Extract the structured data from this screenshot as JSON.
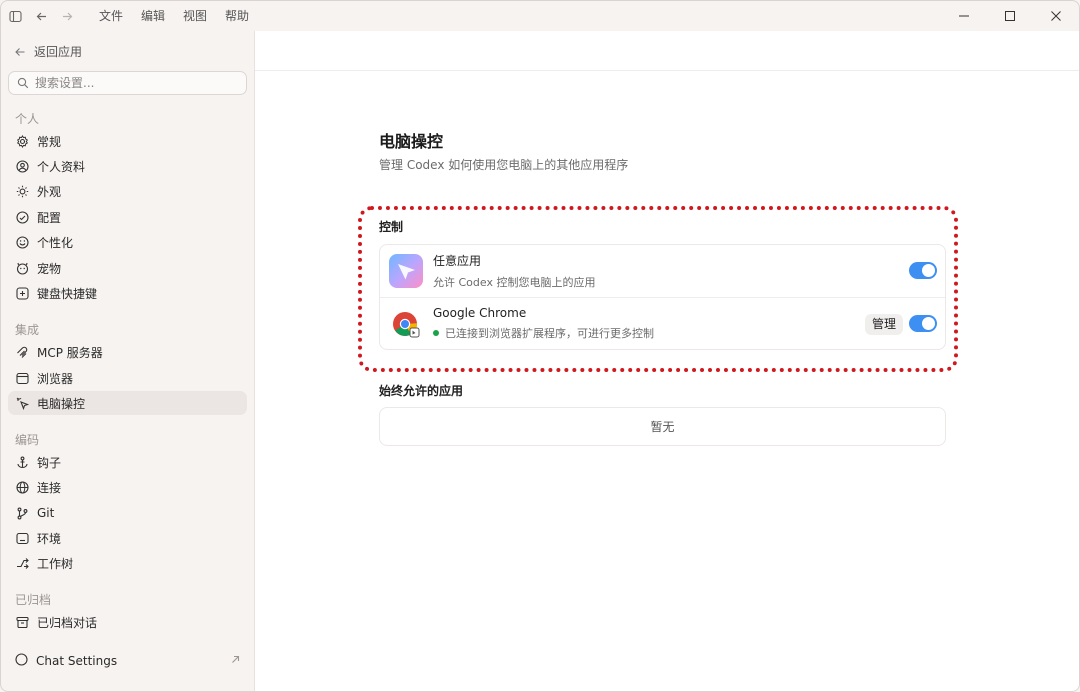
{
  "titlebar": {
    "menu": [
      "文件",
      "编辑",
      "视图",
      "帮助"
    ]
  },
  "sidebar": {
    "back_label": "返回应用",
    "search_placeholder": "搜索设置...",
    "sections": [
      {
        "title": "个人",
        "items": [
          {
            "label": "常规",
            "icon": "gear-icon"
          },
          {
            "label": "个人资料",
            "icon": "user-circle-icon"
          },
          {
            "label": "外观",
            "icon": "sun-icon"
          },
          {
            "label": "配置",
            "icon": "config-icon"
          },
          {
            "label": "个性化",
            "icon": "smile-icon"
          },
          {
            "label": "宠物",
            "icon": "pet-icon"
          },
          {
            "label": "键盘快捷键",
            "icon": "keyboard-icon"
          }
        ]
      },
      {
        "title": "集成",
        "items": [
          {
            "label": "MCP 服务器",
            "icon": "mcp-icon"
          },
          {
            "label": "浏览器",
            "icon": "browser-icon"
          },
          {
            "label": "电脑操控",
            "icon": "computer-control-icon",
            "active": true
          }
        ]
      },
      {
        "title": "编码",
        "items": [
          {
            "label": "钩子",
            "icon": "anchor-icon"
          },
          {
            "label": "连接",
            "icon": "globe-icon"
          },
          {
            "label": "Git",
            "icon": "git-branch-icon"
          },
          {
            "label": "环境",
            "icon": "terminal-icon"
          },
          {
            "label": "工作树",
            "icon": "worktree-icon"
          }
        ]
      },
      {
        "title": "已归档",
        "items": [
          {
            "label": "已归档对话",
            "icon": "archive-icon"
          }
        ]
      }
    ],
    "footer_label": "Chat Settings"
  },
  "main": {
    "title": "电脑操控",
    "subtitle": "管理 Codex 如何使用您电脑上的其他应用程序",
    "control_title": "控制",
    "apps": [
      {
        "name": "任意应用",
        "desc": "允许 Codex 控制您电脑上的应用",
        "enabled": true
      },
      {
        "name": "Google Chrome",
        "desc": "已连接到浏览器扩展程序，可进行更多控制",
        "manage_label": "管理",
        "enabled": true,
        "status_color": "#1aa34a"
      }
    ],
    "allowed_title": "始终允许的应用",
    "allowed_empty": "暂无"
  },
  "colors": {
    "accent": "#3d8ff2",
    "highlight": "#d0191e"
  }
}
